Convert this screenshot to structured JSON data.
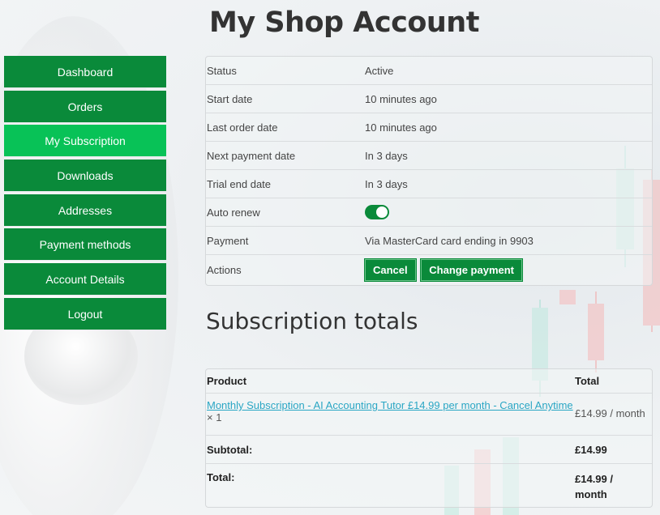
{
  "page": {
    "title": "My Shop Account"
  },
  "sidebar": {
    "items": [
      {
        "label": "Dashboard"
      },
      {
        "label": "Orders"
      },
      {
        "label": "My Subscription"
      },
      {
        "label": "Downloads"
      },
      {
        "label": "Addresses"
      },
      {
        "label": "Payment methods"
      },
      {
        "label": "Account Details"
      },
      {
        "label": "Logout"
      }
    ],
    "active_index": 2
  },
  "subscription": {
    "rows": [
      {
        "label": "Status",
        "value": "Active"
      },
      {
        "label": "Start date",
        "value": "10 minutes ago"
      },
      {
        "label": "Last order date",
        "value": "10 minutes ago"
      },
      {
        "label": "Next payment date",
        "value": "In 3 days"
      },
      {
        "label": "Trial end date",
        "value": "In 3 days"
      }
    ],
    "auto_renew_label": "Auto renew",
    "auto_renew_on": true,
    "payment_label": "Payment",
    "payment_value": "Via MasterCard card ending in 9903",
    "actions_label": "Actions",
    "cancel_label": "Cancel",
    "change_payment_label": "Change payment"
  },
  "totals": {
    "title": "Subscription totals",
    "header_product": "Product",
    "header_total": "Total",
    "product_name": "Monthly Subscription - AI Accounting Tutor £14.99 per month - Cancel Anytime",
    "product_qty_prefix": " × ",
    "product_qty": "1",
    "product_total": "£14.99 / month",
    "subtotal_label": "Subtotal:",
    "subtotal_value": "£14.99",
    "total_label": "Total:",
    "total_value_line1": "£14.99 /",
    "total_value_line2": "month"
  },
  "colors": {
    "nav_green": "#0a8a3a",
    "nav_active": "#08c257",
    "link": "#2aa6c4"
  }
}
